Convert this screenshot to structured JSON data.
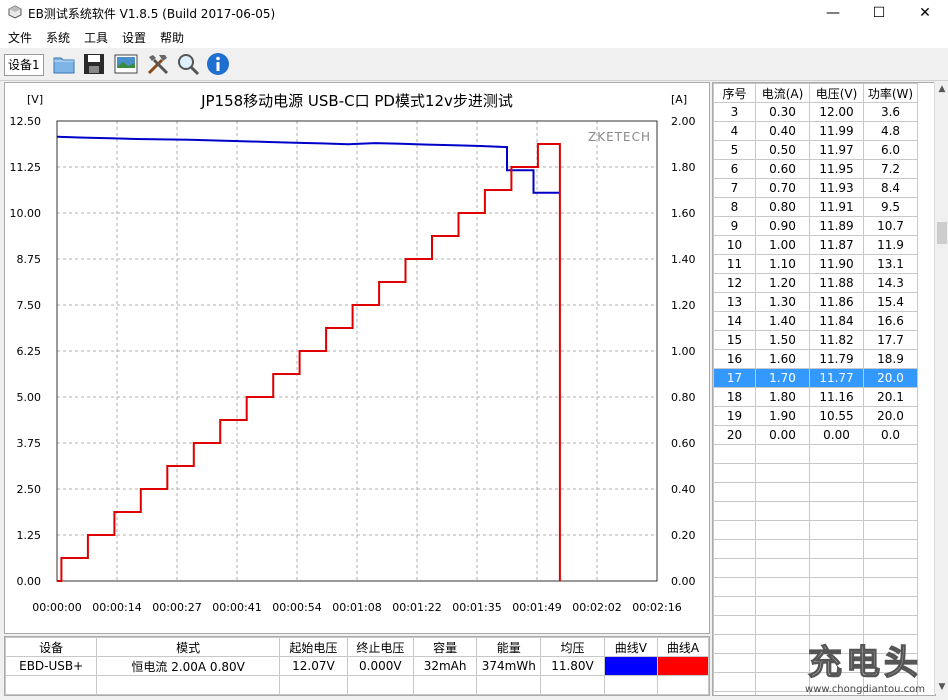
{
  "window": {
    "title": "EB测试系统软件 V1.8.5 (Build 2017-06-05)",
    "minimize": "—",
    "maximize": "☐",
    "close": "✕"
  },
  "menu": [
    "文件",
    "系统",
    "工具",
    "设置",
    "帮助"
  ],
  "toolbar": {
    "device_tab": "设备1",
    "icons": [
      "folder-icon",
      "save-icon",
      "image-icon",
      "tools-icon",
      "zoom-icon",
      "info-icon"
    ]
  },
  "chart_data": {
    "type": "line",
    "title": "JP158移动电源  USB-C口  PD模式12v步进测试",
    "watermark": "ZKETECH",
    "ylabel_left": "[V]",
    "ylabel_right": "[A]",
    "ylim_left": [
      0,
      12.5
    ],
    "ylim_right": [
      0,
      2.0
    ],
    "yticks_left": [
      "0.00",
      "1.25",
      "2.50",
      "3.75",
      "5.00",
      "6.25",
      "7.50",
      "8.75",
      "10.00",
      "11.25",
      "12.50"
    ],
    "yticks_right": [
      "0.00",
      "0.20",
      "0.40",
      "0.60",
      "0.80",
      "1.00",
      "1.20",
      "1.40",
      "1.60",
      "1.80",
      "2.00"
    ],
    "xticks": [
      "00:00:00",
      "00:00:14",
      "00:00:27",
      "00:00:41",
      "00:00:54",
      "00:01:08",
      "00:01:22",
      "00:01:35",
      "00:01:49",
      "00:02:02",
      "00:02:16"
    ],
    "xlim_seconds": [
      0,
      136
    ],
    "grid": true,
    "series": [
      {
        "name": "曲线V",
        "color": "#0000c8",
        "axis": "left",
        "points": [
          [
            0,
            12.07
          ],
          [
            6,
            12.05
          ],
          [
            12,
            12.03
          ],
          [
            18,
            12.01
          ],
          [
            24,
            12.0
          ],
          [
            30,
            11.99
          ],
          [
            36,
            11.97
          ],
          [
            42,
            11.95
          ],
          [
            48,
            11.93
          ],
          [
            54,
            11.91
          ],
          [
            60,
            11.89
          ],
          [
            66,
            11.87
          ],
          [
            72,
            11.9
          ],
          [
            78,
            11.88
          ],
          [
            84,
            11.86
          ],
          [
            90,
            11.84
          ],
          [
            96,
            11.82
          ],
          [
            102,
            11.79
          ],
          [
            102,
            11.16
          ],
          [
            108,
            11.16
          ],
          [
            108,
            10.55
          ],
          [
            114,
            10.55
          ]
        ]
      },
      {
        "name": "曲线A",
        "color": "#e00000",
        "axis": "right",
        "points": [
          [
            0,
            0.0
          ],
          [
            1,
            0.0
          ],
          [
            1,
            0.1
          ],
          [
            7,
            0.1
          ],
          [
            7,
            0.2
          ],
          [
            13,
            0.2
          ],
          [
            13,
            0.3
          ],
          [
            19,
            0.3
          ],
          [
            19,
            0.4
          ],
          [
            25,
            0.4
          ],
          [
            25,
            0.5
          ],
          [
            31,
            0.5
          ],
          [
            31,
            0.6
          ],
          [
            37,
            0.6
          ],
          [
            37,
            0.7
          ],
          [
            43,
            0.7
          ],
          [
            43,
            0.8
          ],
          [
            49,
            0.8
          ],
          [
            49,
            0.9
          ],
          [
            55,
            0.9
          ],
          [
            55,
            1.0
          ],
          [
            61,
            1.0
          ],
          [
            61,
            1.1
          ],
          [
            67,
            1.1
          ],
          [
            67,
            1.2
          ],
          [
            73,
            1.2
          ],
          [
            73,
            1.3
          ],
          [
            79,
            1.3
          ],
          [
            79,
            1.4
          ],
          [
            85,
            1.4
          ],
          [
            85,
            1.5
          ],
          [
            91,
            1.5
          ],
          [
            91,
            1.6
          ],
          [
            97,
            1.6
          ],
          [
            97,
            1.7
          ],
          [
            103,
            1.7
          ],
          [
            103,
            1.8
          ],
          [
            109,
            1.8
          ],
          [
            109,
            1.9
          ],
          [
            114,
            1.9
          ],
          [
            114,
            0.0
          ]
        ]
      }
    ]
  },
  "right_table": {
    "headers": [
      "序号",
      "电流(A)",
      "电压(V)",
      "功率(W)"
    ],
    "rows": [
      [
        "3",
        "0.30",
        "12.00",
        "3.6"
      ],
      [
        "4",
        "0.40",
        "11.99",
        "4.8"
      ],
      [
        "5",
        "0.50",
        "11.97",
        "6.0"
      ],
      [
        "6",
        "0.60",
        "11.95",
        "7.2"
      ],
      [
        "7",
        "0.70",
        "11.93",
        "8.4"
      ],
      [
        "8",
        "0.80",
        "11.91",
        "9.5"
      ],
      [
        "9",
        "0.90",
        "11.89",
        "10.7"
      ],
      [
        "10",
        "1.00",
        "11.87",
        "11.9"
      ],
      [
        "11",
        "1.10",
        "11.90",
        "13.1"
      ],
      [
        "12",
        "1.20",
        "11.88",
        "14.3"
      ],
      [
        "13",
        "1.30",
        "11.86",
        "15.4"
      ],
      [
        "14",
        "1.40",
        "11.84",
        "16.6"
      ],
      [
        "15",
        "1.50",
        "11.82",
        "17.7"
      ],
      [
        "16",
        "1.60",
        "11.79",
        "18.9"
      ],
      [
        "17",
        "1.70",
        "11.77",
        "20.0"
      ],
      [
        "18",
        "1.80",
        "11.16",
        "20.1"
      ],
      [
        "19",
        "1.90",
        "10.55",
        "20.0"
      ],
      [
        "20",
        "0.00",
        "0.00",
        "0.0"
      ]
    ],
    "selected_row": 14,
    "empty_rows": 14
  },
  "bottom_table": {
    "headers": [
      "设备",
      "模式",
      "起始电压",
      "终止电压",
      "容量",
      "能量",
      "均压",
      "曲线V",
      "曲线A"
    ],
    "row": [
      "EBD-USB+",
      "恒电流  2.00A  0.80V",
      "12.07V",
      "0.000V",
      "32mAh",
      "374mWh",
      "11.80V",
      "",
      ""
    ],
    "curve_colors": [
      "#0000ff",
      "#ff0000"
    ]
  },
  "watermark": {
    "logo": "充电头",
    "url": "www.chongdiantou.com"
  }
}
